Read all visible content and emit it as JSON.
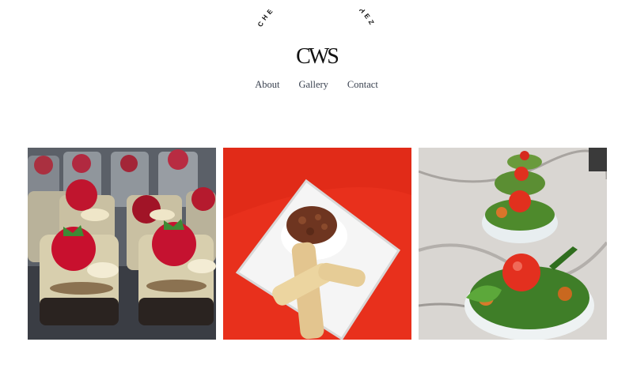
{
  "site": {
    "logo_name": "CHEF WARREN SANCHEZ",
    "logo_monogram": "CWS"
  },
  "nav": {
    "items": [
      "About",
      "Gallery",
      "Contact"
    ]
  },
  "gallery": {
    "images": [
      {
        "subject": "dessert-cups-with-strawberries"
      },
      {
        "subject": "plated-dish-on-red-cloth"
      },
      {
        "subject": "salad-cups-on-marble"
      }
    ]
  }
}
